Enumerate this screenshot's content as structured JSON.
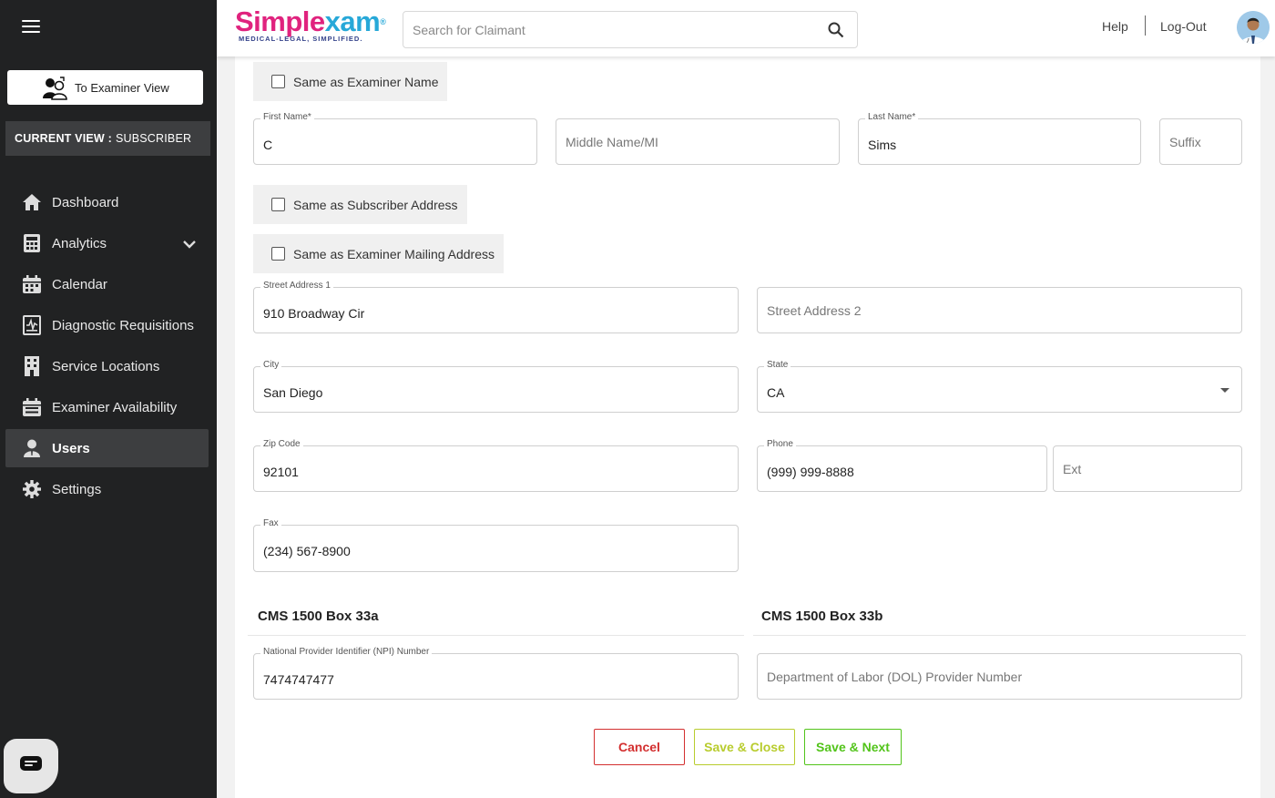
{
  "sidebar": {
    "examiner_view_label": "To Examiner View",
    "current_view_label": "CURRENT VIEW :",
    "current_view_value": "SUBSCRIBER",
    "items": [
      {
        "label": "Dashboard",
        "icon": "home-icon"
      },
      {
        "label": "Analytics",
        "icon": "calculator-icon"
      },
      {
        "label": "Calendar",
        "icon": "calendar-icon"
      },
      {
        "label": "Diagnostic Requisitions",
        "icon": "requisition-icon"
      },
      {
        "label": "Service Locations",
        "icon": "building-icon"
      },
      {
        "label": "Examiner Availability",
        "icon": "calendar-check-icon"
      },
      {
        "label": "Users",
        "icon": "user-icon",
        "active": true
      },
      {
        "label": "Settings",
        "icon": "gear-icon"
      }
    ]
  },
  "header": {
    "logo_simple": "Simple",
    "logo_xam": "xam",
    "logo_tagline": "MEDICAL-LEGAL, SIMPLIFIED.",
    "search_placeholder": "Search for Claimant",
    "help": "Help",
    "logout": "Log-Out"
  },
  "form": {
    "same_examiner_name": "Same as Examiner Name",
    "first_name": {
      "label": "First Name*",
      "value": "C"
    },
    "middle_name": {
      "placeholder": "Middle Name/MI"
    },
    "last_name": {
      "label": "Last Name*",
      "value": "Sims"
    },
    "suffix": {
      "placeholder": "Suffix"
    },
    "same_subscriber_address": "Same as Subscriber Address",
    "same_examiner_mailing": "Same as Examiner Mailing Address",
    "street1": {
      "label": "Street Address 1",
      "value": "910 Broadway Cir"
    },
    "street2": {
      "placeholder": "Street Address 2"
    },
    "city": {
      "label": "City",
      "value": "San Diego"
    },
    "state": {
      "label": "State",
      "value": "CA"
    },
    "zip": {
      "label": "Zip Code",
      "value": "92101"
    },
    "phone": {
      "label": "Phone",
      "value": "(999) 999-8888"
    },
    "ext": {
      "placeholder": "Ext"
    },
    "fax": {
      "label": "Fax",
      "value": "(234) 567-8900"
    },
    "box33a_title": "CMS 1500 Box 33a",
    "box33b_title": "CMS 1500 Box 33b",
    "npi": {
      "label": "National Provider Identifier (NPI) Number",
      "value": "7474747477"
    },
    "dol": {
      "placeholder": "Department of Labor (DOL) Provider Number"
    }
  },
  "actions": {
    "cancel": "Cancel",
    "save_close": "Save & Close",
    "save_next": "Save & Next"
  },
  "colors": {
    "sidebar_bg": "#212223",
    "cancel": "#d32f2f",
    "save_close": "#b8cc2d",
    "save_next": "#52c41a",
    "brand_pink": "#e0237e",
    "brand_blue": "#27a8d8"
  }
}
